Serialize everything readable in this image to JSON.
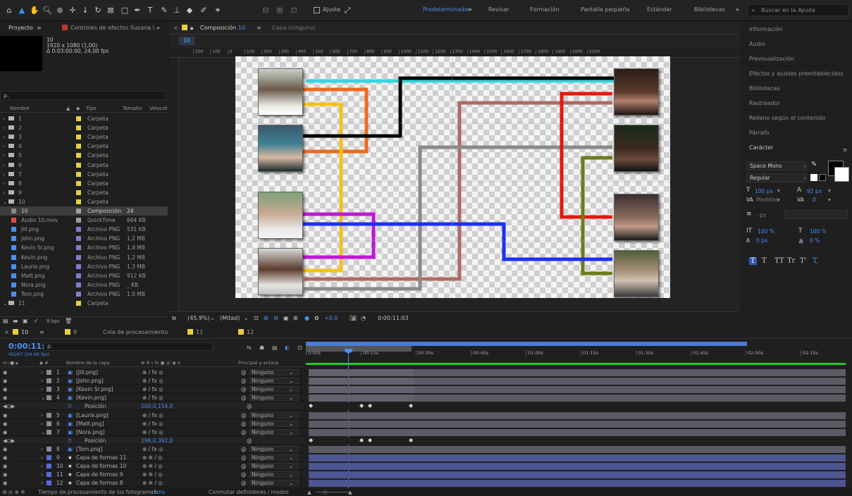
{
  "toolbar": {
    "ajuste": "Ajuste",
    "workspaces": [
      "Predeterminado",
      "Revisar",
      "Formación",
      "Pantalla pequeña",
      "Estándar",
      "Bibliotecas"
    ],
    "help_placeholder": "Buscar en la Ayuda",
    "more": "»"
  },
  "project": {
    "tab": "Proyecto",
    "effects_tab": "Controles de efectos Susana \\",
    "item_name": "10",
    "item_res": "1920 x 1080 (1,00)",
    "item_dur": "Δ 0:03:00:00, 24,00 fps",
    "search_icon": "ρ.",
    "col_name": "Nombre",
    "col_type": "Tipo",
    "col_size": "Tamaño",
    "col_speed": "Velocid",
    "rows": [
      {
        "name": "1",
        "type": "Carpeta",
        "size": "",
        "kind": "folder",
        "color": "#e8cf40",
        "sel": false
      },
      {
        "name": "2",
        "type": "Carpeta",
        "size": "",
        "kind": "folder",
        "color": "#e8cf40",
        "sel": false
      },
      {
        "name": "3",
        "type": "Carpeta",
        "size": "",
        "kind": "folder",
        "color": "#e8cf40",
        "sel": false
      },
      {
        "name": "4",
        "type": "Carpeta",
        "size": "",
        "kind": "folder",
        "color": "#e8cf40",
        "sel": false
      },
      {
        "name": "5",
        "type": "Carpeta",
        "size": "",
        "kind": "folder",
        "color": "#e8cf40",
        "sel": false
      },
      {
        "name": "6",
        "type": "Carpeta",
        "size": "",
        "kind": "folder",
        "color": "#e8cf40",
        "sel": false
      },
      {
        "name": "7",
        "type": "Carpeta",
        "size": "",
        "kind": "folder",
        "color": "#e8cf40",
        "sel": false
      },
      {
        "name": "8",
        "type": "Carpeta",
        "size": "",
        "kind": "folder",
        "color": "#e8cf40",
        "sel": false
      },
      {
        "name": "9",
        "type": "Carpeta",
        "size": "",
        "kind": "folder",
        "color": "#e8cf40",
        "sel": false
      },
      {
        "name": "10",
        "type": "Carpeta",
        "size": "",
        "kind": "folder",
        "color": "#e8cf40",
        "sel": false
      },
      {
        "name": "10",
        "type": "Composición",
        "size": "24",
        "kind": "comp",
        "color": "#a0a0a0",
        "sel": true
      },
      {
        "name": "Audio 10.mov",
        "type": "QuickTime",
        "size": "664 KB",
        "kind": "mov",
        "color": "#a0a0a0",
        "sel": false
      },
      {
        "name": "Jill.png",
        "type": "Archivo PNG",
        "size": "531 KB",
        "kind": "png",
        "color": "#7f7fd0",
        "sel": false
      },
      {
        "name": "John.png",
        "type": "Archivo PNG",
        "size": "1,2 MB",
        "kind": "png",
        "color": "#7f7fd0",
        "sel": false
      },
      {
        "name": "Kevin Sr.png",
        "type": "Archivo PNG",
        "size": "1,4 MB",
        "kind": "png",
        "color": "#7f7fd0",
        "sel": false
      },
      {
        "name": "Kevin.png",
        "type": "Archivo PNG",
        "size": "1,2 MB",
        "kind": "png",
        "color": "#7f7fd0",
        "sel": false
      },
      {
        "name": "Laurie.png",
        "type": "Archivo PNG",
        "size": "1,3 MB",
        "kind": "png",
        "color": "#7f7fd0",
        "sel": false
      },
      {
        "name": "Matt.png",
        "type": "Archivo PNG",
        "size": "912 KB",
        "kind": "png",
        "color": "#7f7fd0",
        "sel": false
      },
      {
        "name": "Nora.png",
        "type": "Archivo PNG",
        "size": "_ KB",
        "kind": "png",
        "color": "#7f7fd0",
        "sel": false
      },
      {
        "name": "Tom.png",
        "type": "Archivo PNG",
        "size": "1,0 MB",
        "kind": "png",
        "color": "#7f7fd0",
        "sel": false
      },
      {
        "name": "11",
        "type": "Carpeta",
        "size": "",
        "kind": "folder",
        "color": "#e8cf40",
        "sel": false
      }
    ],
    "bpc": "8 bpc"
  },
  "comp": {
    "tab_label": "Composición",
    "tab_num": "10",
    "layer_tab": "Capa (ninguno)",
    "crumb": "10",
    "ruler": [
      "200",
      "100",
      "0",
      "100",
      "200",
      "300",
      "400",
      "500",
      "600",
      "700",
      "800",
      "900",
      "1000",
      "1100",
      "1200",
      "1300",
      "1400",
      "1500",
      "1600",
      "1700",
      "1800",
      "1900",
      "2000",
      "2100"
    ],
    "zoom": "(45,9%)",
    "resolution": "(Mitad)",
    "exposure": "+0,0",
    "timecode": "0:00:11:03"
  },
  "right_panel": {
    "items": [
      "Información",
      "Audio",
      "Previsualización",
      "Efectos y ajustes preestablecidos",
      "Bibliotecas",
      "Rastreador",
      "Relleno según el contenido",
      "Párrafo",
      "Carácter"
    ],
    "font": "Space Mono",
    "style": "Regular",
    "size": "100 px",
    "leading": "92 px",
    "kerning": "Medidas",
    "tracking": "0",
    "indent": "- px",
    "vscale": "100 %",
    "hscale": "100 %",
    "baseline": "0 px",
    "tsume": "0 %",
    "styles": [
      "T",
      "T",
      "TT",
      "Tr",
      "T'",
      "T,"
    ]
  },
  "timeline": {
    "tabs": [
      {
        "label": "10",
        "color": "#e8cf40"
      },
      {
        "label": "9",
        "color": "#e8cf40"
      },
      {
        "label": "Cola de procesamiento",
        "color": ""
      },
      {
        "label": "11",
        "color": "#e8cf40"
      },
      {
        "label": "12",
        "color": "#e8cf40"
      }
    ],
    "current_time": "0:00:11:03",
    "frames": "00267 (24.00 fps)",
    "col_name": "Nombre de la capa",
    "col_parent": "Principal y enlace",
    "ticks": [
      "0:00s",
      "00:15s",
      "00:30s",
      "00:45s",
      "01:00s",
      "01:15s",
      "01:30s",
      "01:45s",
      "02:00s",
      "02:15s"
    ],
    "layers": [
      {
        "num": "1",
        "name": "[Jill.png]",
        "parent": "Ninguno",
        "kind": "img",
        "prop": false
      },
      {
        "num": "2",
        "name": "[John.png]",
        "parent": "Ninguno",
        "kind": "img",
        "prop": false
      },
      {
        "num": "3",
        "name": "[Kevin Sr.png]",
        "parent": "Ninguno",
        "kind": "img",
        "prop": false
      },
      {
        "num": "4",
        "name": "[Kevin.png]",
        "parent": "Ninguno",
        "kind": "img",
        "prop": false
      },
      {
        "num": "",
        "name": "Posición",
        "parent": "",
        "value": "200,0,154,0",
        "kind": "prop",
        "prop": true
      },
      {
        "num": "5",
        "name": "[Laurie.png]",
        "parent": "Ninguno",
        "kind": "img",
        "prop": false
      },
      {
        "num": "6",
        "name": "[Matt.png]",
        "parent": "Ninguno",
        "kind": "img",
        "prop": false
      },
      {
        "num": "7",
        "name": "[Nora.png]",
        "parent": "Ninguno",
        "kind": "img",
        "prop": false
      },
      {
        "num": "",
        "name": "Posición",
        "parent": "",
        "value": "198,0,392,0",
        "kind": "prop",
        "prop": true
      },
      {
        "num": "8",
        "name": "[Tom.png]",
        "parent": "Ninguno",
        "kind": "img",
        "prop": false
      },
      {
        "num": "9",
        "name": "Capa de formas 11",
        "parent": "Ninguno",
        "kind": "shape",
        "prop": false
      },
      {
        "num": "10",
        "name": "Capa de formas 10",
        "parent": "Ninguno",
        "kind": "shape",
        "prop": false
      },
      {
        "num": "11",
        "name": "Capa de formas 9",
        "parent": "Ninguno",
        "kind": "shape",
        "prop": false
      },
      {
        "num": "12",
        "name": "Capa de formas 8",
        "parent": "Ninguno",
        "kind": "shape",
        "prop": false
      }
    ],
    "status": "Tiempo de procesamiento de los fotogramas:",
    "status_val": "5ms",
    "status_mid": "Conmutar definidores / modos"
  },
  "colors": {
    "accent": "#4a8ef0",
    "line_cyan": "#38d6e0",
    "line_orange": "#ef6a1f",
    "line_yellow": "#f5c11a",
    "line_black": "#050505",
    "line_brown": "#b06a62",
    "line_gray": "#8a8a8a",
    "line_red": "#e8160c",
    "line_olive": "#6e7a1d",
    "line_purple": "#c018d8",
    "line_blue": "#1d2ff0"
  }
}
